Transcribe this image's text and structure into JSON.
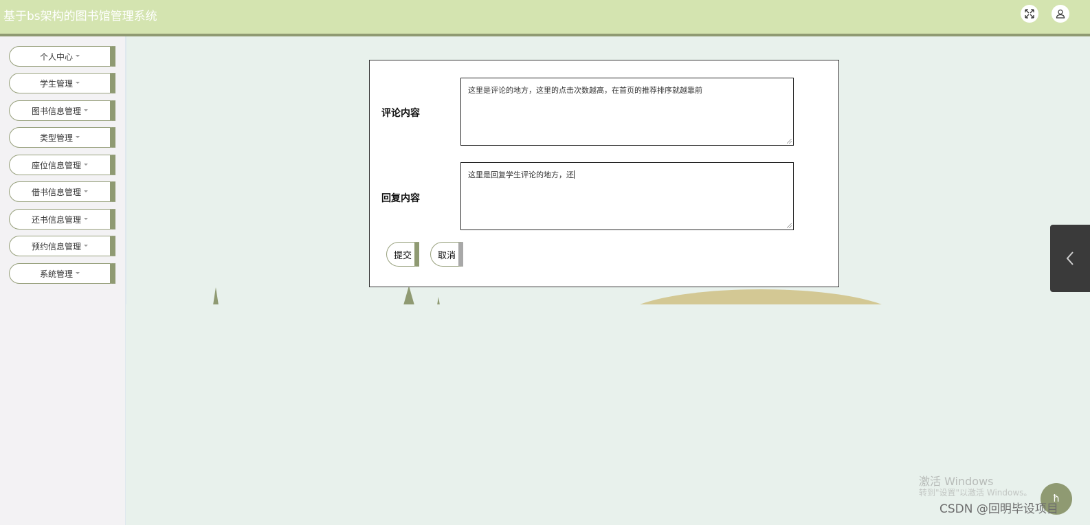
{
  "header": {
    "app_title": "基于bs架构的图书馆管理系统",
    "fullscreen_icon": "expand-icon",
    "user_icon": "user-icon"
  },
  "sidebar": {
    "items": [
      {
        "label": "个人中心"
      },
      {
        "label": "学生管理"
      },
      {
        "label": "图书信息管理"
      },
      {
        "label": "类型管理"
      },
      {
        "label": "座位信息管理"
      },
      {
        "label": "借书信息管理"
      },
      {
        "label": "还书信息管理"
      },
      {
        "label": "预约信息管理"
      },
      {
        "label": "系统管理"
      }
    ]
  },
  "form": {
    "comment_label": "评论内容",
    "comment_value": "这里是评论的地方，这里的点击次数越高，在首页的推荐排序就越靠前",
    "reply_label": "回复内容",
    "reply_value": "这里是回复学生评论的地方，还",
    "submit_label": "提交",
    "cancel_label": "取消"
  },
  "side_tab_icon": "chevron-left-icon",
  "watermark": {
    "line1": "激活 Windows",
    "line2": "转到\"设置\"以激活 Windows。"
  },
  "footer": {
    "csdn": "CSDN @回明毕设项目",
    "float_label": "ħ"
  },
  "colors": {
    "header_bg": "#d4e4b0",
    "accent": "#8f9a72",
    "page_bg": "#e8f1ec"
  }
}
